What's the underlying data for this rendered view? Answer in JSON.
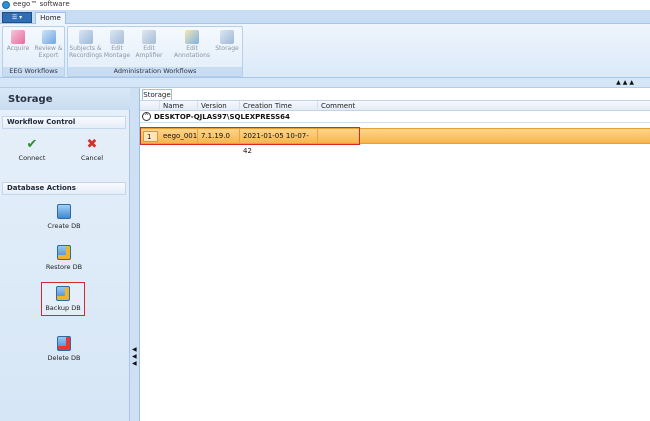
{
  "window": {
    "title": "eego™ software"
  },
  "ribbon_tabs": {
    "app_menu_label": "☰ ▾",
    "home_label": "Home"
  },
  "ribbon": {
    "eeg_group_label": "EEG Workflows",
    "admin_group_label": "Administration Workflows",
    "buttons": [
      {
        "label": "Acquire",
        "icon": "acquire-icon"
      },
      {
        "label": "Review & Export",
        "icon": "review-icon"
      },
      {
        "label": "Subjects & Recordings",
        "icon": "subjects-icon"
      },
      {
        "label": "Edit Montage",
        "icon": "montage-icon"
      },
      {
        "label": "Edit Amplifier",
        "icon": "amplifier-icon"
      },
      {
        "label": "Edit Annotations",
        "icon": "annotations-icon"
      },
      {
        "label": "Storage",
        "icon": "storage-icon"
      }
    ]
  },
  "collapse": {
    "arrows": "▲▲▲"
  },
  "left_panel": {
    "title": "Storage",
    "workflow_control": {
      "title": "Workflow Control",
      "connect_label": "Connect",
      "cancel_label": "Cancel"
    },
    "database_actions": {
      "title": "Database Actions",
      "items": [
        {
          "label": "Create DB"
        },
        {
          "label": "Restore DB"
        },
        {
          "label": "Backup DB"
        },
        {
          "label": "Delete DB"
        }
      ]
    }
  },
  "splitter": {
    "arrows": "◀\n◀\n◀"
  },
  "content": {
    "tab_label": "Storage",
    "columns": [
      "Name",
      "Version",
      "Creation Time",
      "Comment"
    ],
    "group": {
      "toggle": "^",
      "name": "DESKTOP-QJLAS97\\SQLEXPRESS64"
    },
    "rows": [
      {
        "index": "1",
        "name": "eego_001",
        "version": "7.1.19.0",
        "creation_time": "2021-01-05 10-07-42",
        "comment": ""
      }
    ]
  },
  "colors": {
    "ribbon_bg": "#dbe9f8",
    "selected_row": "#f7b54d",
    "highlight_border": "#d42a2a"
  }
}
